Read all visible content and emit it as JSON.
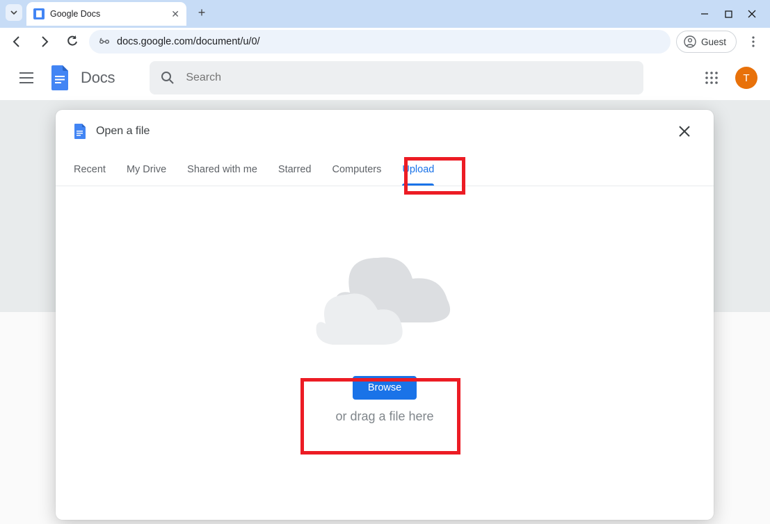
{
  "browser": {
    "tab_title": "Google Docs",
    "url": "docs.google.com/document/u/0/",
    "guest_label": "Guest"
  },
  "header": {
    "product_name": "Docs",
    "search_placeholder": "Search",
    "avatar_letter": "T"
  },
  "dialog": {
    "title": "Open a file",
    "tabs": [
      "Recent",
      "My Drive",
      "Shared with me",
      "Starred",
      "Computers",
      "Upload"
    ],
    "active_tab": "Upload",
    "browse_label": "Browse",
    "drag_text": "or drag a file here"
  }
}
